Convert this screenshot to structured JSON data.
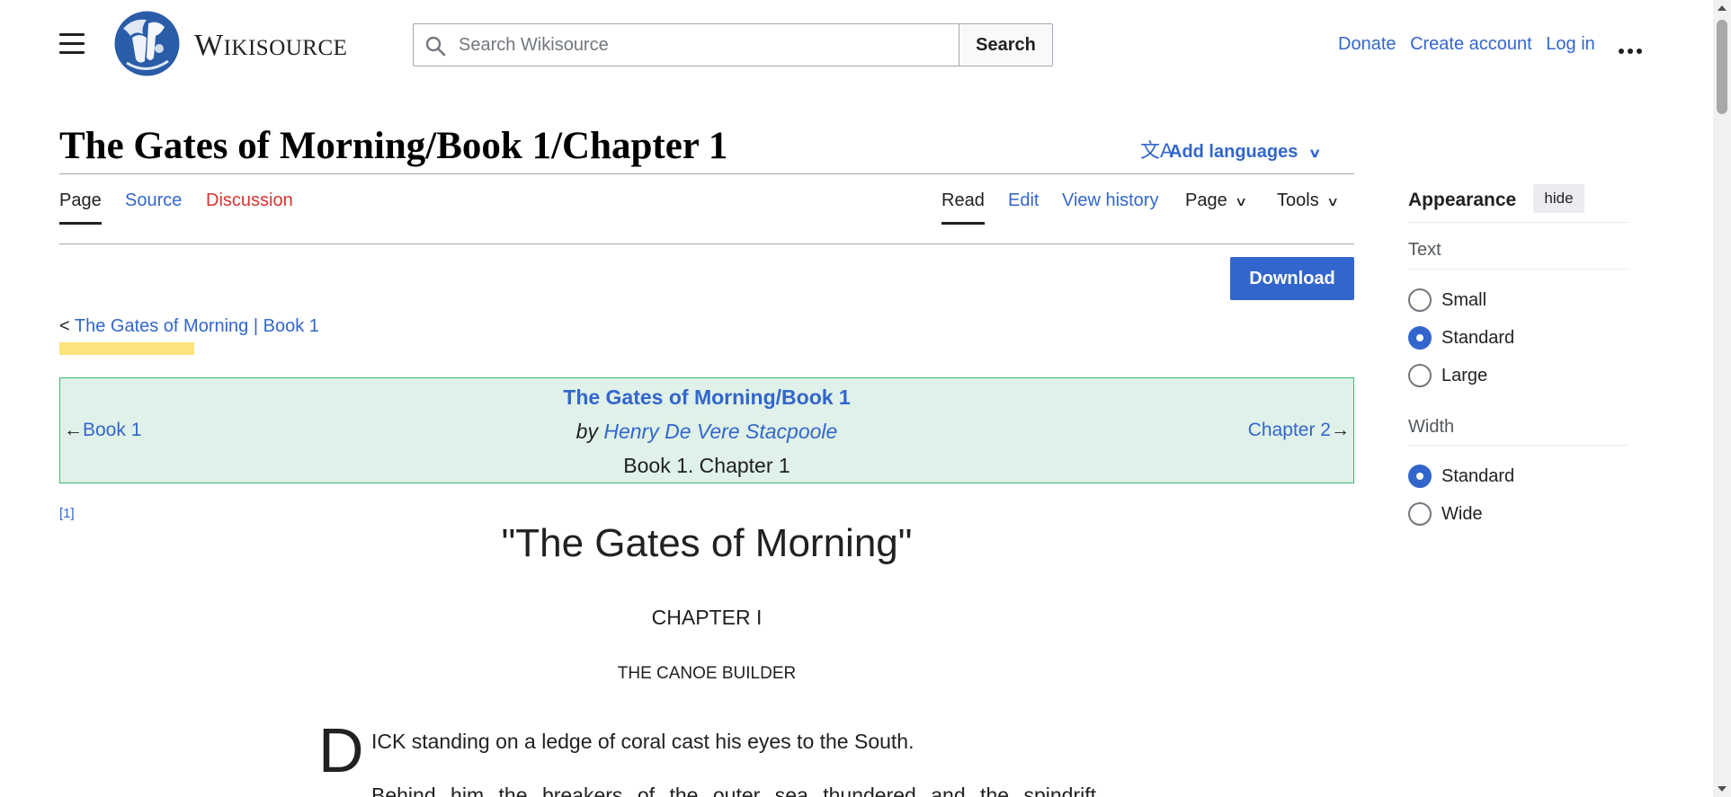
{
  "header": {
    "wordmark_first": "W",
    "wordmark_rest": "IKISOURCE",
    "search_placeholder": "Search Wikisource",
    "search_button": "Search",
    "user_links": [
      "Donate",
      "Create account",
      "Log in"
    ]
  },
  "page": {
    "title": "The Gates of Morning/Book 1/Chapter 1",
    "add_languages": "Add languages",
    "left_tabs": [
      "Page",
      "Source",
      "Discussion"
    ],
    "right_tabs": [
      "Read",
      "Edit",
      "View history"
    ],
    "menu_tabs": [
      "Page",
      "Tools"
    ],
    "download": "Download",
    "breadcrumb": {
      "prefix": "< ",
      "work": "The Gates of Morning",
      "sep": " | ",
      "part": "Book 1"
    }
  },
  "header_box": {
    "title": "The Gates of Morning/Book 1",
    "by": "by",
    "author": "Henry De Vere Stacpoole",
    "section": "Book 1. Chapter 1",
    "prev_arrow": "←",
    "prev": "Book 1",
    "next": "Chapter 2",
    "next_arrow": "→"
  },
  "content": {
    "footnote": "[1]",
    "heading": "\"The Gates of Morning\"",
    "chapter": "CHAPTER I",
    "subtitle": "THE CANOE BUILDER",
    "dropcap": "D",
    "para1": "ICK standing on a ledge of coral cast his eyes to the South.",
    "para2": "Behind him the breakers of the outer sea thundered and the spindrift"
  },
  "appearance": {
    "title": "Appearance",
    "hide": "hide",
    "text_heading": "Text",
    "text_options": [
      "Small",
      "Standard",
      "Large"
    ],
    "text_selected": "Standard",
    "width_heading": "Width",
    "width_options": [
      "Standard",
      "Wide"
    ],
    "width_selected": "Standard"
  },
  "colors": {
    "link": "#3366cc",
    "red_link": "#d73333",
    "header_box_bg": "#dff1e8",
    "header_box_border": "#3cb878",
    "primary_button": "#3366cc",
    "highlight": "#fce37c"
  },
  "icons": [
    "hamburger-icon",
    "wikisource-logo",
    "search-icon",
    "translate-icon",
    "chevron-down-icon",
    "ellipsis-icon"
  ]
}
